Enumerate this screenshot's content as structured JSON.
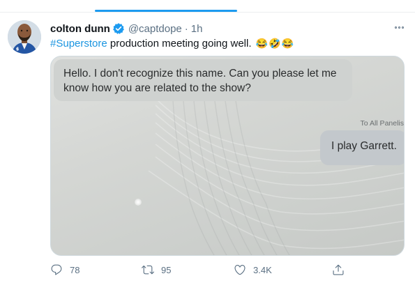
{
  "tweet": {
    "author": {
      "display_name": "colton dunn",
      "handle": "@captdope",
      "verified": true
    },
    "separator": "·",
    "time": "1h",
    "text": {
      "hashtag": "#Superstore",
      "body": " production meeting going well.",
      "emoji": "😂🤣😂"
    },
    "media": {
      "message_left": "Hello. I don't recognize this name. Can you please let me know how you are related to the show?",
      "recipient_label": "To All Panelis",
      "message_right": "I play Garrett."
    },
    "actions": {
      "replies": "78",
      "retweets": "95",
      "likes": "3.4K"
    }
  },
  "colors": {
    "accent": "#1d9bf0",
    "hashtag": "#1b95e0",
    "secondary_text": "#5b7083"
  },
  "icons": [
    "verified-badge-icon",
    "more-icon",
    "reply-icon",
    "retweet-icon",
    "like-icon",
    "share-icon"
  ]
}
